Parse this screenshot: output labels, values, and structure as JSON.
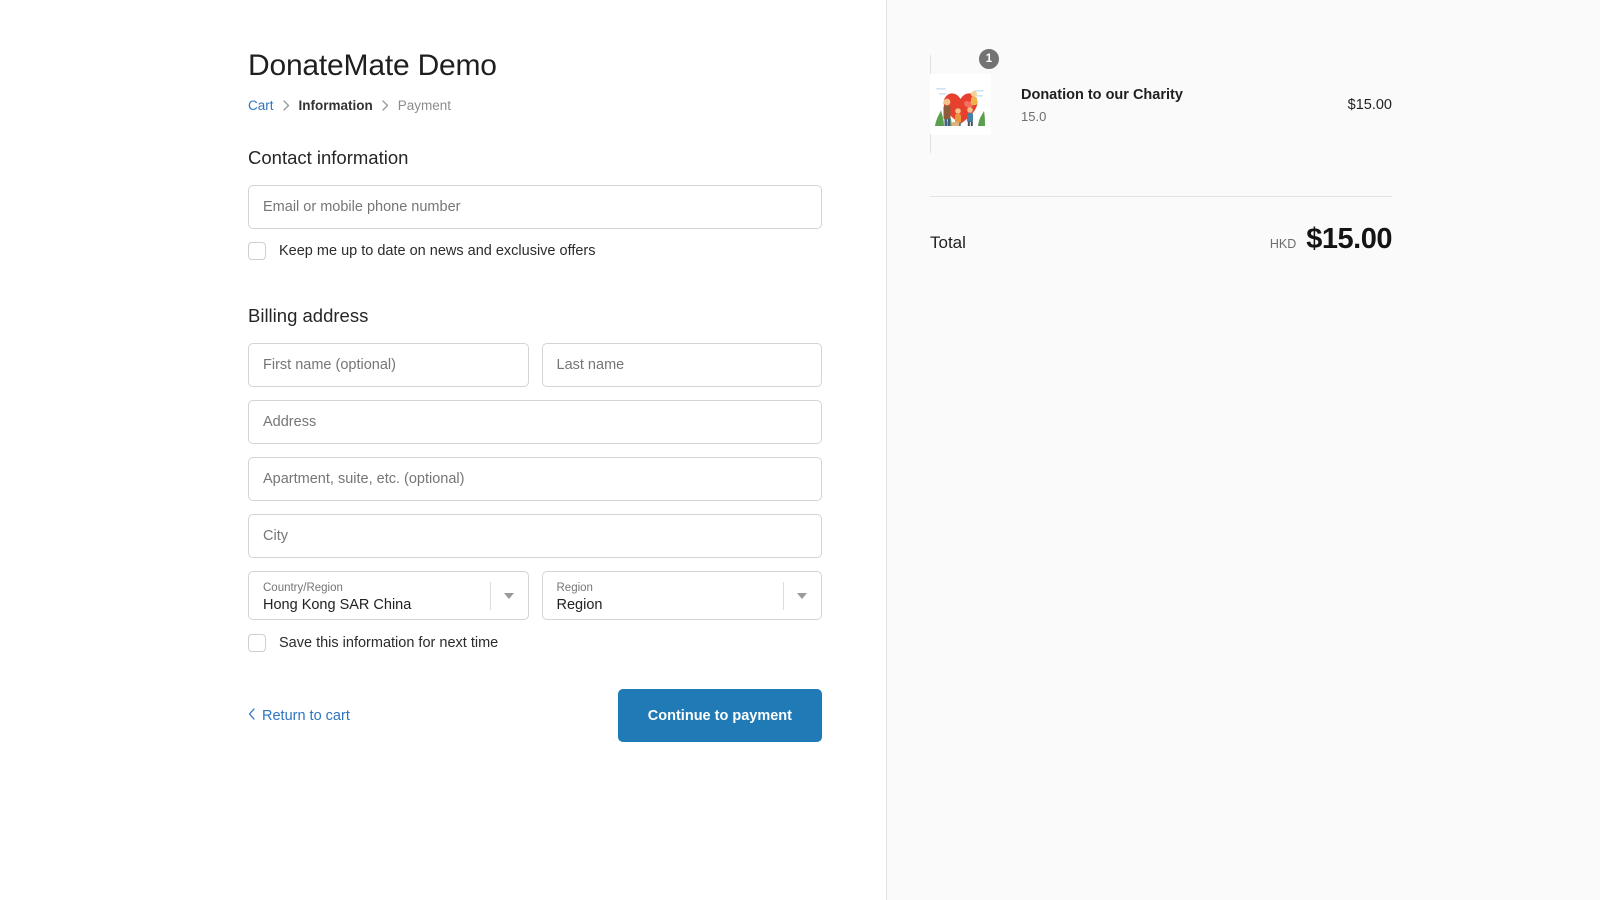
{
  "shop": {
    "title": "DonateMate Demo"
  },
  "breadcrumb": {
    "cart": "Cart",
    "information": "Information",
    "payment": "Payment"
  },
  "contact": {
    "heading": "Contact information",
    "email_placeholder": "Email or mobile phone number",
    "email_value": "",
    "newsletter_label": "Keep me up to date on news and exclusive offers",
    "newsletter_checked": false
  },
  "billing": {
    "heading": "Billing address",
    "first_name_placeholder": "First name (optional)",
    "first_name_value": "",
    "last_name_placeholder": "Last name",
    "last_name_value": "",
    "address_placeholder": "Address",
    "address_value": "",
    "apartment_placeholder": "Apartment, suite, etc. (optional)",
    "apartment_value": "",
    "city_placeholder": "City",
    "city_value": "",
    "country": {
      "label": "Country/Region",
      "value": "Hong Kong SAR China"
    },
    "region": {
      "label": "Region",
      "value": "Region"
    },
    "save_label": "Save this information for next time",
    "save_checked": false
  },
  "actions": {
    "return_label": "Return to cart",
    "continue_label": "Continue to payment"
  },
  "summary": {
    "item": {
      "title": "Donation to our Charity",
      "variant": "15.0",
      "quantity": "1",
      "price": "$15.00"
    },
    "total": {
      "label": "Total",
      "currency": "HKD",
      "amount": "$15.00"
    }
  },
  "colors": {
    "accent_blue": "#1f7ab5",
    "link_blue": "#2f74c0",
    "panel_bg": "#fafafa",
    "border": "#d4d4d4"
  }
}
